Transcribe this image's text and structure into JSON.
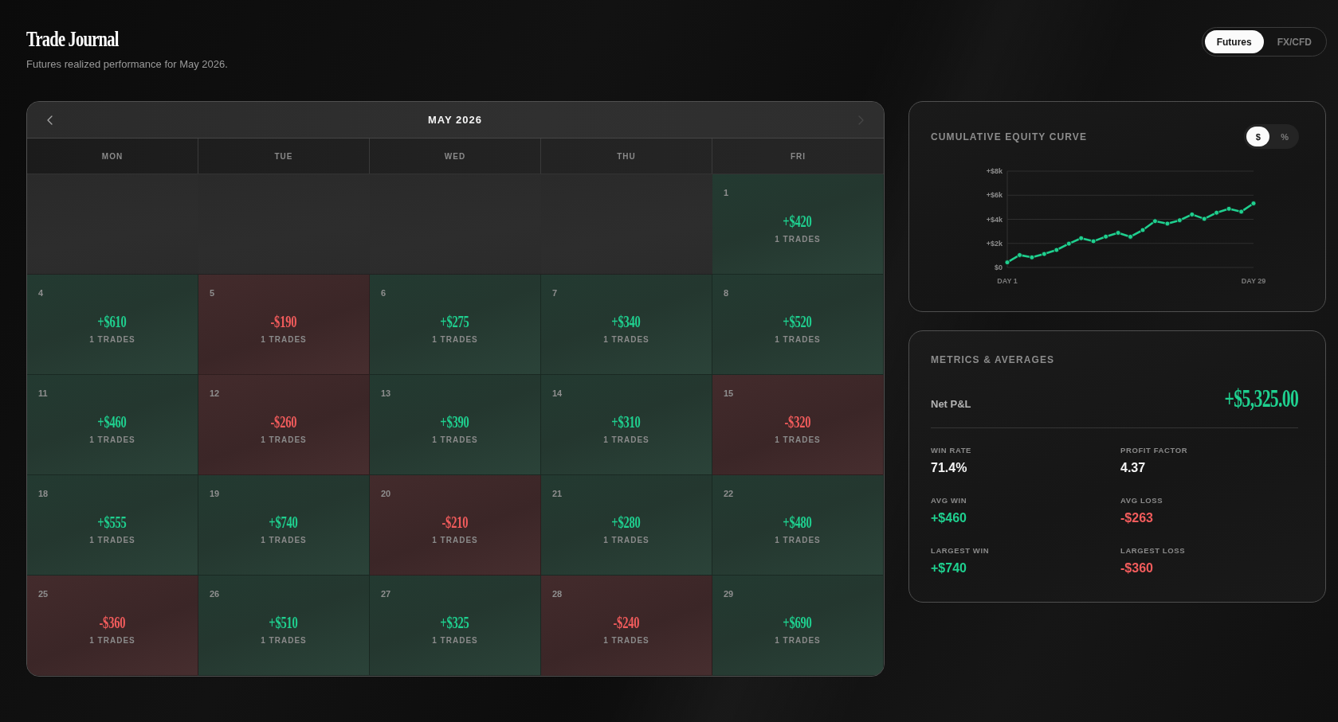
{
  "header": {
    "title": "Trade Journal",
    "subtitle": "Futures realized performance for May 2026."
  },
  "tabs": [
    {
      "label": "Futures",
      "selected": true
    },
    {
      "label": "FX/CFD",
      "selected": false
    }
  ],
  "calendar": {
    "month": "MAY 2026",
    "prev_button": {
      "disabled": false
    },
    "next_button": {
      "disabled": true
    },
    "weekdays": [
      "MON",
      "TUE",
      "WED",
      "THU",
      "FRI"
    ],
    "days": [
      {
        "kind": "empty"
      },
      {
        "kind": "empty"
      },
      {
        "kind": "empty"
      },
      {
        "kind": "empty"
      },
      {
        "kind": "profit",
        "date": "1",
        "pnl": "+$420",
        "trades": "1 TRADES"
      },
      {
        "kind": "profit",
        "date": "4",
        "pnl": "+$610",
        "trades": "1 TRADES"
      },
      {
        "kind": "loss",
        "date": "5",
        "pnl": "-$190",
        "trades": "1 TRADES"
      },
      {
        "kind": "profit",
        "date": "6",
        "pnl": "+$275",
        "trades": "1 TRADES"
      },
      {
        "kind": "profit",
        "date": "7",
        "pnl": "+$340",
        "trades": "1 TRADES"
      },
      {
        "kind": "profit",
        "date": "8",
        "pnl": "+$520",
        "trades": "1 TRADES"
      },
      {
        "kind": "profit",
        "date": "11",
        "pnl": "+$460",
        "trades": "1 TRADES"
      },
      {
        "kind": "loss",
        "date": "12",
        "pnl": "-$260",
        "trades": "1 TRADES"
      },
      {
        "kind": "profit",
        "date": "13",
        "pnl": "+$390",
        "trades": "1 TRADES"
      },
      {
        "kind": "profit",
        "date": "14",
        "pnl": "+$310",
        "trades": "1 TRADES"
      },
      {
        "kind": "loss",
        "date": "15",
        "pnl": "-$320",
        "trades": "1 TRADES"
      },
      {
        "kind": "profit",
        "date": "18",
        "pnl": "+$555",
        "trades": "1 TRADES"
      },
      {
        "kind": "profit",
        "date": "19",
        "pnl": "+$740",
        "trades": "1 TRADES"
      },
      {
        "kind": "loss",
        "date": "20",
        "pnl": "-$210",
        "trades": "1 TRADES"
      },
      {
        "kind": "profit",
        "date": "21",
        "pnl": "+$280",
        "trades": "1 TRADES"
      },
      {
        "kind": "profit",
        "date": "22",
        "pnl": "+$480",
        "trades": "1 TRADES"
      },
      {
        "kind": "loss",
        "date": "25",
        "pnl": "-$360",
        "trades": "1 TRADES"
      },
      {
        "kind": "profit",
        "date": "26",
        "pnl": "+$510",
        "trades": "1 TRADES"
      },
      {
        "kind": "profit",
        "date": "27",
        "pnl": "+$325",
        "trades": "1 TRADES"
      },
      {
        "kind": "loss",
        "date": "28",
        "pnl": "-$240",
        "trades": "1 TRADES"
      },
      {
        "kind": "profit",
        "date": "29",
        "pnl": "+$690",
        "trades": "1 TRADES"
      }
    ]
  },
  "equity_curve": {
    "title": "CUMULATIVE EQUITY CURVE",
    "unit_toggle": [
      {
        "label": "$",
        "selected": true
      },
      {
        "label": "%",
        "selected": false
      }
    ],
    "chart_data": {
      "type": "line",
      "categories": [
        "DAY 1",
        null,
        null,
        null,
        null,
        null,
        null,
        null,
        null,
        null,
        null,
        null,
        null,
        null,
        null,
        null,
        null,
        null,
        null,
        null,
        "DAY 29"
      ],
      "series": [
        {
          "color": "#1fcf8e",
          "marker": "circle",
          "values": [
            420,
            1030,
            840,
            1115,
            1455,
            1975,
            2435,
            2175,
            2565,
            2875,
            2555,
            3110,
            3850,
            3640,
            3920,
            4400,
            4040,
            4550,
            4875,
            4635,
            5325
          ]
        }
      ],
      "ylim": [
        0,
        8000
      ],
      "yticks": [
        {
          "value": 0,
          "label": "$0"
        },
        {
          "value": 2000,
          "label": "+$2k"
        },
        {
          "value": 4000,
          "label": "+$4k"
        },
        {
          "value": 6000,
          "label": "+$6k"
        },
        {
          "value": 8000,
          "label": "+$8k"
        }
      ],
      "grid": true
    }
  },
  "metrics": {
    "title": "METRICS & AVERAGES",
    "net_pnl": {
      "label": "Net P&L",
      "value": "+$5,325.00",
      "kind": "profit"
    },
    "stats": [
      {
        "label": "WIN RATE",
        "value": "71.4%",
        "kind": "neutral"
      },
      {
        "label": "PROFIT FACTOR",
        "value": "4.37",
        "kind": "neutral"
      },
      {
        "label": "AVG WIN",
        "value": "+$460",
        "kind": "profit"
      },
      {
        "label": "AVG LOSS",
        "value": "-$263",
        "kind": "loss"
      },
      {
        "label": "LARGEST WIN",
        "value": "+$740",
        "kind": "profit"
      },
      {
        "label": "LARGEST LOSS",
        "value": "-$360",
        "kind": "loss"
      }
    ]
  }
}
